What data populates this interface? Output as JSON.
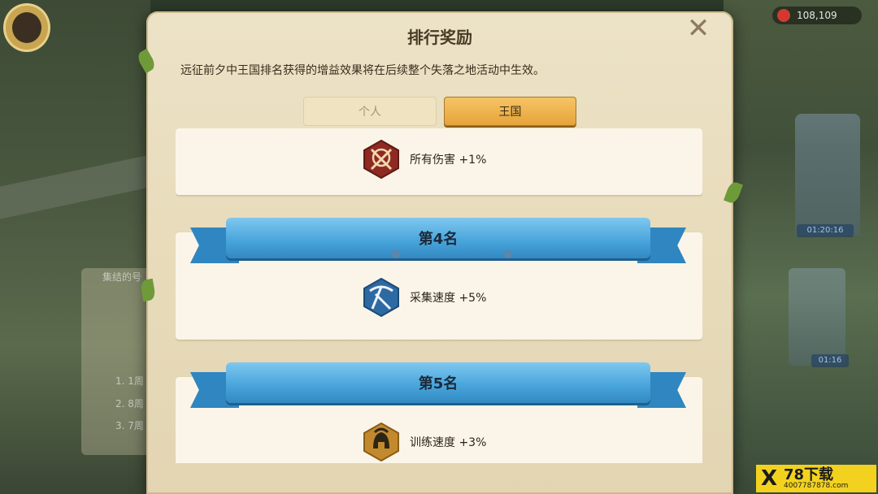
{
  "background": {
    "resource_count": "108,109",
    "timers": [
      "01:20:16",
      "01:16"
    ],
    "left_texts": [
      "集结的号",
      "1. 1周",
      "2. 8周",
      "3. 7周"
    ]
  },
  "dialog": {
    "title": "排行奖励",
    "description": "远征前夕中王国排名获得的增益效果将在后续整个失落之地活动中生效。",
    "close_label": "✕",
    "tabs": [
      {
        "label": "个人",
        "selected": false
      },
      {
        "label": "王国",
        "selected": true
      }
    ]
  },
  "rewards": [
    {
      "rank_label": "",
      "buff_text": "所有伤害 +1%",
      "icon": "swords-icon",
      "icon_color": "#a8342a"
    },
    {
      "rank_label": "第4名",
      "buff_text": "采集速度 +5%",
      "icon": "pickaxe-icon",
      "icon_color": "#2f6ea8"
    },
    {
      "rank_label": "第5名",
      "buff_text": "训练速度 +3%",
      "icon": "helmet-icon",
      "icon_color": "#c48a2c"
    }
  ],
  "watermark": {
    "brand": "78下载",
    "site": "4007787878.com"
  },
  "colors": {
    "parchment": "#e8dcbc",
    "ribbon_blue": "#4aa6dc",
    "tab_active": "#e6a33b"
  }
}
